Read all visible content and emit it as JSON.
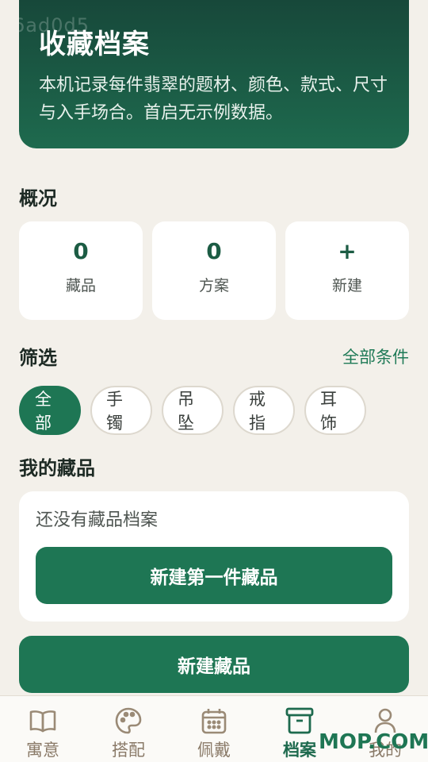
{
  "hero": {
    "watermark": "6ad0d5",
    "title": "收藏档案",
    "description": "本机记录每件翡翠的题材、颜色、款式、尺寸与入手场合。首启无示例数据。"
  },
  "overview": {
    "title": "概况",
    "stats": [
      {
        "value": "0",
        "label": "藏品"
      },
      {
        "value": "0",
        "label": "方案"
      },
      {
        "value": "+",
        "label": "新建"
      }
    ]
  },
  "filter": {
    "title": "筛选",
    "all_conditions_link": "全部条件",
    "chips": [
      "全部",
      "手镯",
      "吊坠",
      "戒指",
      "耳饰"
    ],
    "selected": "全部"
  },
  "collection": {
    "title": "我的藏品",
    "empty_text": "还没有藏品档案",
    "create_first_label": "新建第一件藏品"
  },
  "primary_action": {
    "label": "新建藏品"
  },
  "tabbar": {
    "items": [
      {
        "label": "寓意",
        "icon": "book-icon"
      },
      {
        "label": "搭配",
        "icon": "palette-icon"
      },
      {
        "label": "佩戴",
        "icon": "calendar-icon"
      },
      {
        "label": "档案",
        "icon": "archive-box-icon"
      },
      {
        "label": "我的",
        "icon": "person-icon"
      }
    ],
    "active": "档案"
  },
  "overlay_mark": "MOP.COM",
  "colors": {
    "accent": "#1e7654",
    "hero_dark": "#17483a",
    "background": "#f3f0ea",
    "tab_inactive": "#8a7a68"
  }
}
